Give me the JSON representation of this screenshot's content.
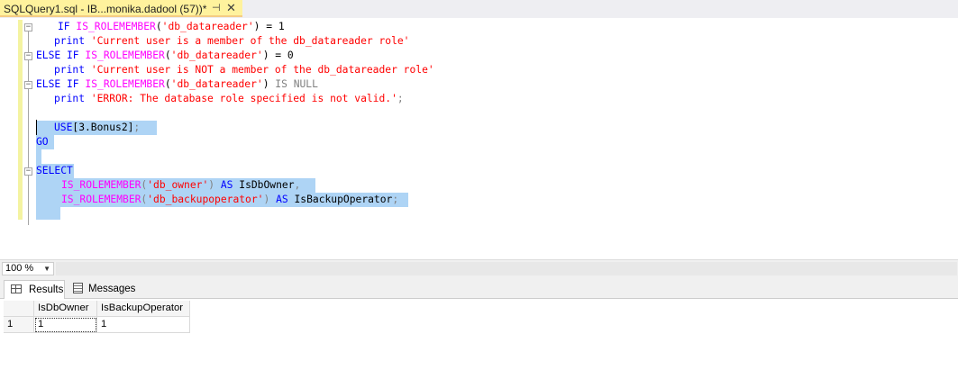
{
  "tab": {
    "title": "SQLQuery1.sql - IB...monika.dadool (57))*",
    "pin_glyph": "⊣",
    "close_glyph": "✕"
  },
  "editor": {
    "lines": [
      [
        [
          "kw",
          "IF "
        ],
        [
          "fn",
          "IS_ROLEMEMBER"
        ],
        [
          "",
          "("
        ],
        [
          "str",
          "'db_datareader'"
        ],
        [
          "",
          ") = 1"
        ]
      ],
      [
        [
          "kw",
          "print "
        ],
        [
          "str",
          "'Current user is a member of the db_datareader role'"
        ]
      ],
      [
        [
          "kw",
          "ELSE IF "
        ],
        [
          "fn",
          "IS_ROLEMEMBER"
        ],
        [
          "",
          ""
        ],
        [
          "",
          "("
        ],
        [
          "str",
          "'db_datareader'"
        ],
        [
          "",
          ") = 0"
        ]
      ],
      [
        [
          "kw",
          "print "
        ],
        [
          "str",
          "'Current user is NOT a member of the db_datareader role'"
        ]
      ],
      [
        [
          "kw",
          "ELSE IF "
        ],
        [
          "fn",
          "IS_ROLEMEMBER"
        ],
        [
          "",
          ""
        ],
        [
          "",
          "("
        ],
        [
          "str",
          "'db_datareader'"
        ],
        [
          "",
          ") "
        ],
        [
          "gray",
          "IS NULL"
        ]
      ],
      [
        [
          "kw",
          "print "
        ],
        [
          "str",
          "'ERROR: The database role specified is not valid.'"
        ],
        [
          "gray",
          ";"
        ]
      ],
      [],
      [
        [
          "kw",
          "USE"
        ],
        [
          "",
          "[3.Bonus2]"
        ],
        [
          "gray",
          ";"
        ]
      ],
      [
        [
          "kw",
          "GO"
        ]
      ],
      [],
      [
        [
          "kw",
          "SELECT"
        ]
      ],
      [
        [
          "fn",
          "IS_ROLEMEMBER"
        ],
        [
          "gray",
          "("
        ],
        [
          "str",
          "'db_owner'"
        ],
        [
          "gray",
          ")"
        ],
        [
          "kw",
          " AS "
        ],
        [
          "",
          "IsDbOwner"
        ],
        [
          "gray",
          ","
        ]
      ],
      [
        [
          "fn",
          "IS_ROLEMEMBER"
        ],
        [
          "gray",
          "("
        ],
        [
          "str",
          "'db_backupoperator'"
        ],
        [
          "gray",
          ")"
        ],
        [
          "kw",
          " AS "
        ],
        [
          "",
          "IsBackupOperator"
        ],
        [
          "gray",
          ";"
        ]
      ],
      []
    ]
  },
  "zoom": {
    "value": "100 %"
  },
  "results_tabs": [
    {
      "label": "Results"
    },
    {
      "label": "Messages"
    }
  ],
  "results": {
    "columns": [
      "",
      "IsDbOwner",
      "IsBackupOperator"
    ],
    "rows": [
      [
        "1",
        "1",
        "1"
      ]
    ]
  }
}
